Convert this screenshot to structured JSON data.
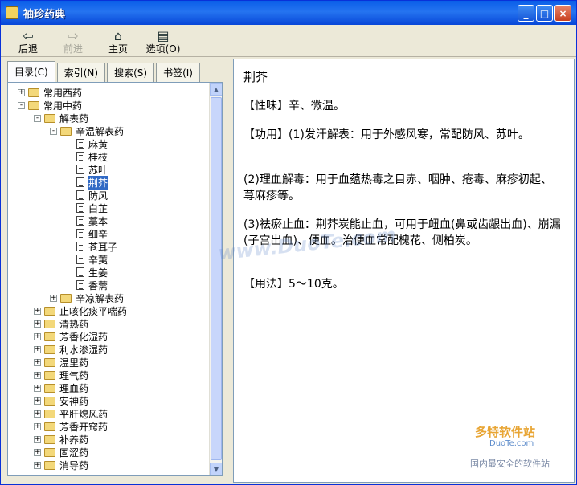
{
  "window": {
    "title": "袖珍药典"
  },
  "toolbar": {
    "back_label": "后退",
    "forward_label": "前进",
    "home_label": "主页",
    "options_label": "选项(O)"
  },
  "tabs": [
    "目录(C)",
    "索引(N)",
    "搜索(S)",
    "书签(I)"
  ],
  "tree": [
    {
      "label": "常用西药",
      "level": 0,
      "expander": "+",
      "icon": "folder"
    },
    {
      "label": "常用中药",
      "level": 0,
      "expander": "-",
      "icon": "folder"
    },
    {
      "label": "解表药",
      "level": 1,
      "expander": "-",
      "icon": "folder"
    },
    {
      "label": "辛温解表药",
      "level": 2,
      "expander": "-",
      "icon": "folder"
    },
    {
      "label": "麻黄",
      "level": 3,
      "expander": "",
      "icon": "doc"
    },
    {
      "label": "桂枝",
      "level": 3,
      "expander": "",
      "icon": "doc"
    },
    {
      "label": "苏叶",
      "level": 3,
      "expander": "",
      "icon": "doc"
    },
    {
      "label": "荆芥",
      "level": 3,
      "expander": "",
      "icon": "doc",
      "selected": true
    },
    {
      "label": "防风",
      "level": 3,
      "expander": "",
      "icon": "doc"
    },
    {
      "label": "白芷",
      "level": 3,
      "expander": "",
      "icon": "doc"
    },
    {
      "label": "藁本",
      "level": 3,
      "expander": "",
      "icon": "doc"
    },
    {
      "label": "细辛",
      "level": 3,
      "expander": "",
      "icon": "doc"
    },
    {
      "label": "苍耳子",
      "level": 3,
      "expander": "",
      "icon": "doc"
    },
    {
      "label": "辛荑",
      "level": 3,
      "expander": "",
      "icon": "doc"
    },
    {
      "label": "生姜",
      "level": 3,
      "expander": "",
      "icon": "doc"
    },
    {
      "label": "香薷",
      "level": 3,
      "expander": "",
      "icon": "doc"
    },
    {
      "label": "辛凉解表药",
      "level": 2,
      "expander": "+",
      "icon": "folder"
    },
    {
      "label": "止咳化痰平喘药",
      "level": 1,
      "expander": "+",
      "icon": "folder"
    },
    {
      "label": "清热药",
      "level": 1,
      "expander": "+",
      "icon": "folder"
    },
    {
      "label": "芳香化湿药",
      "level": 1,
      "expander": "+",
      "icon": "folder"
    },
    {
      "label": "利水渗湿药",
      "level": 1,
      "expander": "+",
      "icon": "folder"
    },
    {
      "label": "温里药",
      "level": 1,
      "expander": "+",
      "icon": "folder"
    },
    {
      "label": "理气药",
      "level": 1,
      "expander": "+",
      "icon": "folder"
    },
    {
      "label": "理血药",
      "level": 1,
      "expander": "+",
      "icon": "folder"
    },
    {
      "label": "安神药",
      "level": 1,
      "expander": "+",
      "icon": "folder"
    },
    {
      "label": "平肝熄风药",
      "level": 1,
      "expander": "+",
      "icon": "folder"
    },
    {
      "label": "芳香开窍药",
      "level": 1,
      "expander": "+",
      "icon": "folder"
    },
    {
      "label": "补养药",
      "level": 1,
      "expander": "+",
      "icon": "folder"
    },
    {
      "label": "固涩药",
      "level": 1,
      "expander": "+",
      "icon": "folder"
    },
    {
      "label": "消导药",
      "level": 1,
      "expander": "+",
      "icon": "folder"
    }
  ],
  "content": {
    "title": "荆芥",
    "xingwei": "【性味】辛、微温。",
    "gongyong1": "【功用】(1)发汗解表：用于外感风寒，常配防风、苏叶。",
    "gongyong2": "(2)理血解毒：用于血蕴热毒之目赤、咽肿、疮毒、麻疹初起、荨麻疹等。",
    "gongyong3": "(3)祛瘀止血：荆芥炭能止血，可用于衄血(鼻或齿龈出血)、崩漏(子宫出血)、便血。治便血常配槐花、侧柏炭。",
    "yongfa": "【用法】5～10克。"
  },
  "watermarks": {
    "center": "www.DuoTe.com",
    "corner_brand": "多特软件站",
    "corner_url": "DuoTe.com",
    "corner_slogan": "国内最安全的软件站"
  }
}
